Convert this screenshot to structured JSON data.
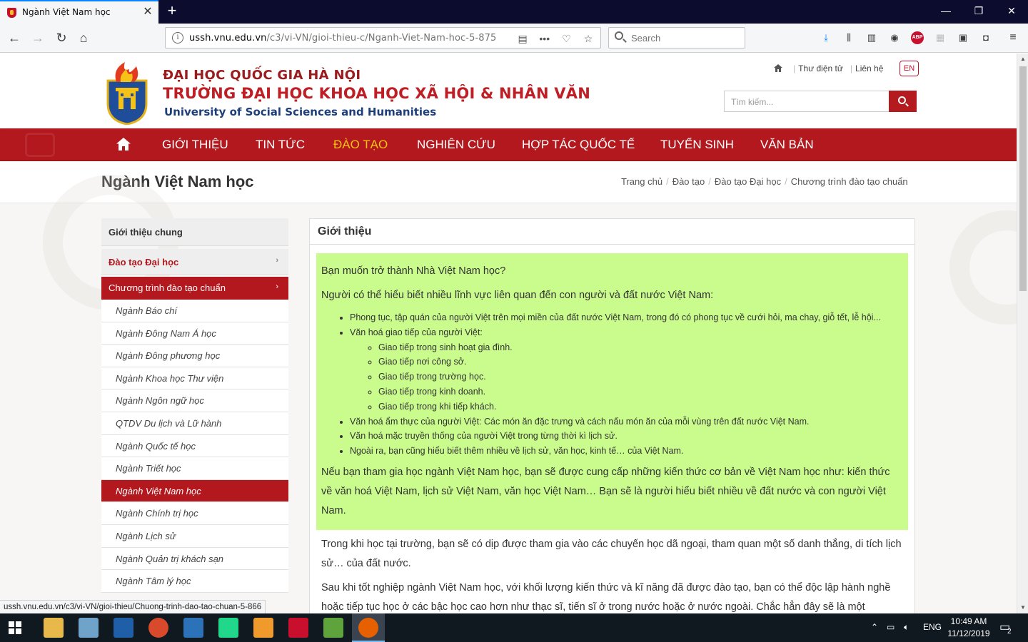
{
  "browser": {
    "tab_title": "Ngành Việt Nam học",
    "url_host": "ussh.vnu.edu.vn",
    "url_path": "/c3/vi-VN/gioi-thieu-c/Nganh-Viet-Nam-hoc-5-875",
    "search_placeholder": "Search",
    "status_url": "ussh.vnu.edu.vn/c3/vi-VN/gioi-thieu/Chuong-trinh-dao-tao-chuan-5-866"
  },
  "header": {
    "line1": "ĐẠI HỌC QUỐC GIA HÀ NỘI",
    "line2": "TRƯỜNG ĐẠI HỌC KHOA HỌC XÃ HỘI & NHÂN VĂN",
    "line3": "University of Social Sciences and Humanities",
    "link_mail": "Thư điện tử",
    "link_contact": "Liên hệ",
    "lang": "EN",
    "search_placeholder": "Tìm kiếm..."
  },
  "menu": {
    "items": [
      "GIỚI THIỆU",
      "TIN TỨC",
      "ĐÀO TẠO",
      "NGHIÊN CỨU",
      "HỢP TÁC QUỐC TẾ",
      "TUYỂN SINH",
      "VĂN BẢN"
    ],
    "active_index": 2
  },
  "page": {
    "title": "Ngành Việt Nam học",
    "breadcrumb": [
      "Trang chủ",
      "Đào tạo",
      "Đào tạo Đại học",
      "Chương trình đào tạo chuẩn"
    ]
  },
  "sidebar": {
    "head": "Giới thiệu chung",
    "category": "Đào tạo Đại học",
    "subcategory": "Chương trình đào tạo chuẩn",
    "items": [
      "Ngành Báo chí",
      "Ngành Đông Nam Á học",
      "Ngành Đông phương học",
      "Ngành Khoa học Thư viện",
      "Ngành Ngôn ngữ học",
      "QTDV Du lịch và Lữ hành",
      "Ngành Quốc tế học",
      "Ngành Triết học",
      "Ngành Việt Nam học",
      "Ngành Chính trị học",
      "Ngành Lịch sử",
      "Ngành Quản trị khách sạn",
      "Ngành Tâm lý học"
    ],
    "active_index": 8
  },
  "content": {
    "heading": "Giới thiệu",
    "p1": "Bạn muốn trở thành Nhà Việt Nam học?",
    "p2": "Người có thể hiểu biết nhiều lĩnh vực liên quan đến con người và đất nước Việt Nam:",
    "b1": "Phong tục, tập quán của người Việt trên mọi miền của đất nước Việt Nam, trong đó có phong tục về cưới hỏi, ma chay, giỗ tết, lễ hội...",
    "b2": "Văn hoá giao tiếp của người Việt:",
    "b2_sub": [
      "Giao tiếp trong sinh hoạt gia đình.",
      "Giao tiếp nơi công sở.",
      "Giao tiếp trong trường học.",
      "Giao tiếp trong kinh doanh.",
      "Giao tiếp trong khi tiếp khách."
    ],
    "b3": "Văn hoá ẩm thực của người Việt: Các món ăn đặc trưng và cách nấu món ăn của mỗi vùng trên đất nước Việt Nam.",
    "b4": "Văn hoá mặc truyền thống của người Việt trong từng thời kì lịch sử.",
    "b5": "Ngoài ra, bạn cũng hiểu biết thêm nhiều về lịch sử, văn học, kinh tế… của Việt Nam.",
    "p3": "Nếu bạn tham gia học ngành Việt Nam học, bạn sẽ được cung cấp những kiến thức cơ bản về Việt Nam học như: kiến thức về văn hoá Việt Nam, lịch sử Việt Nam, văn học Việt Nam… Bạn sẽ là người hiểu biết nhiều về đất nước và con người Việt Nam.",
    "p4": "Trong khi học tại trường, bạn sẽ có dịp được tham gia vào các chuyến học dã ngoại, tham quan một số danh thắng, di tích lịch sử… của đất nước.",
    "p5": "Sau khi tốt nghiệp ngành Việt Nam học, với khối lượng kiến thức và kĩ năng đã được đào tạo, bạn có thể độc lập hành nghề hoặc tiếp tục học ở các bậc học cao hơn như thạc sĩ, tiến sĩ ở trong nước hoặc ở nước ngoài. Chắc hẳn đây sẽ là một"
  },
  "taskbar": {
    "lang": "ENG",
    "time": "10:49 AM",
    "date": "11/12/2019",
    "notif_count": "2"
  },
  "colors": {
    "brand_red": "#b2181d",
    "highlight_green": "#c9fc8c",
    "menu_active": "#f5c218"
  }
}
